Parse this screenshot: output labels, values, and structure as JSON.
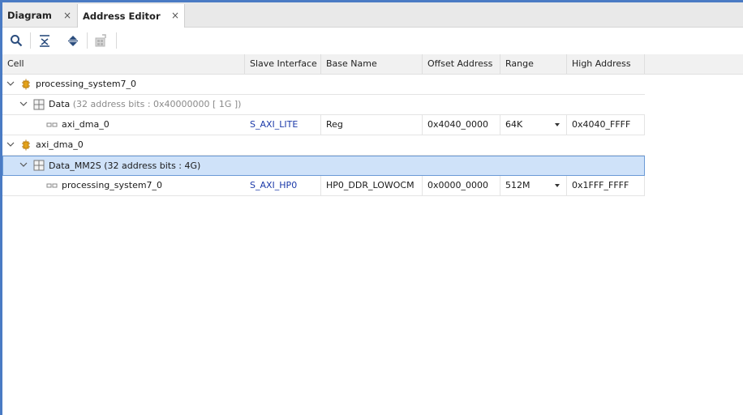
{
  "tabs": [
    {
      "label": "Diagram",
      "active": false
    },
    {
      "label": "Address Editor",
      "active": true
    }
  ],
  "tab_close_glyph": "×",
  "toolbar": {
    "buttons": [
      "search-icon",
      "collapse-all-icon",
      "expand-all-icon",
      "auto-assign-icon"
    ]
  },
  "table": {
    "columns": [
      "Cell",
      "Slave Interface",
      "Base Name",
      "Offset Address",
      "Range",
      "High Address"
    ],
    "rows": [
      {
        "level": 0,
        "expanded": true,
        "icon": "processor-icon",
        "label": "processing_system7_0"
      },
      {
        "level": 1,
        "expanded": true,
        "icon": "address-space-icon",
        "label": "Data",
        "detail": "(32 address bits : 0x40000000 [ 1G ])"
      },
      {
        "level": 2,
        "icon": "slave-segment-icon",
        "label": "axi_dma_0",
        "slave_interface": "S_AXI_LITE",
        "base_name": "Reg",
        "offset": "0x4040_0000",
        "range": "64K",
        "high": "0x4040_FFFF"
      },
      {
        "level": 0,
        "expanded": true,
        "icon": "processor-icon",
        "label": "axi_dma_0"
      },
      {
        "level": 1,
        "expanded": true,
        "icon": "address-space-icon",
        "label": "Data_MM2S (32 address bits : 4G)",
        "selected": true
      },
      {
        "level": 2,
        "icon": "slave-segment-icon",
        "label": "processing_system7_0",
        "slave_interface": "S_AXI_HP0",
        "base_name": "HP0_DDR_LOWOCM",
        "offset": "0x0000_0000",
        "range": "512M",
        "high": "0x1FFF_FFFF"
      }
    ]
  },
  "colors": {
    "accent": "#4a7bc4",
    "selection": "#cfe2f9",
    "link": "#1c3aa9"
  }
}
